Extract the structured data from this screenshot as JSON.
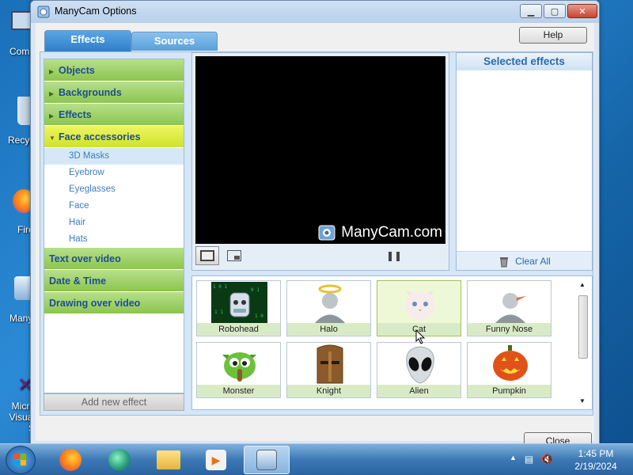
{
  "window": {
    "title": "ManyCam Options"
  },
  "desktop_labels": [
    "Comp",
    "Recycl",
    "Fire",
    "Many",
    "Micro Visual S"
  ],
  "tabs": [
    {
      "label": "Effects",
      "active": true
    },
    {
      "label": "Sources",
      "active": false
    }
  ],
  "help_label": "Help",
  "sidebar": {
    "categories": [
      {
        "label": "Objects"
      },
      {
        "label": "Backgrounds"
      },
      {
        "label": "Effects"
      },
      {
        "label": "Face accessories"
      }
    ],
    "subitems": [
      "3D Masks",
      "Eyebrow",
      "Eyeglasses",
      "Face",
      "Hair",
      "Hats"
    ],
    "bottom_categories": [
      "Text over video",
      "Date & Time",
      "Drawing over video"
    ]
  },
  "add_effect_label": "Add new effect",
  "preview": {
    "logo_text": "ManyCam.com"
  },
  "selected_effects": {
    "title": "Selected effects",
    "clear_label": "Clear All"
  },
  "effects": [
    {
      "name": "Robohead"
    },
    {
      "name": "Halo"
    },
    {
      "name": "Cat"
    },
    {
      "name": "Funny Nose"
    },
    {
      "name": "Monster"
    },
    {
      "name": "Knight"
    },
    {
      "name": "Alien"
    },
    {
      "name": "Pumpkin"
    }
  ],
  "close_label": "Close",
  "taskbar": {
    "time": "1:45 PM",
    "date": "2/19/2024"
  }
}
